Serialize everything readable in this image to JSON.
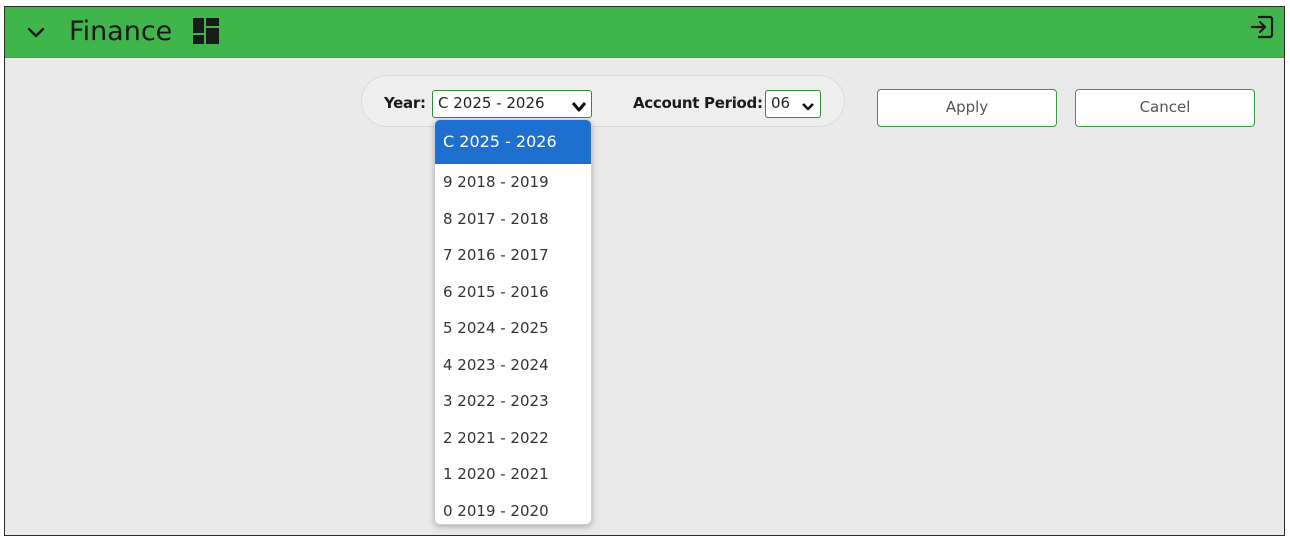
{
  "header": {
    "title": "Finance",
    "color": "#3fb54c",
    "collapse_icon": "chevron-down-icon",
    "widget_icon": "dashboard-grid-icon",
    "exit_icon": "exit-icon"
  },
  "filters": {
    "year_label": "Year:",
    "year_selected": "C 2025 - 2026",
    "period_label": "Account Period:",
    "period_selected": "06"
  },
  "buttons": {
    "apply": "Apply",
    "cancel": "Cancel"
  },
  "year_options": [
    "C 2025 - 2026",
    "9 2018 - 2019",
    "8 2017 - 2018",
    "7 2016 - 2017",
    "6 2015 - 2016",
    "5 2024 - 2025",
    "4 2023 - 2024",
    "3 2022 - 2023",
    "2 2021 - 2022",
    "1 2020 - 2021",
    "0 2019 - 2020"
  ],
  "selected_year_index": 0,
  "highlight_color": "#1f6fd1"
}
